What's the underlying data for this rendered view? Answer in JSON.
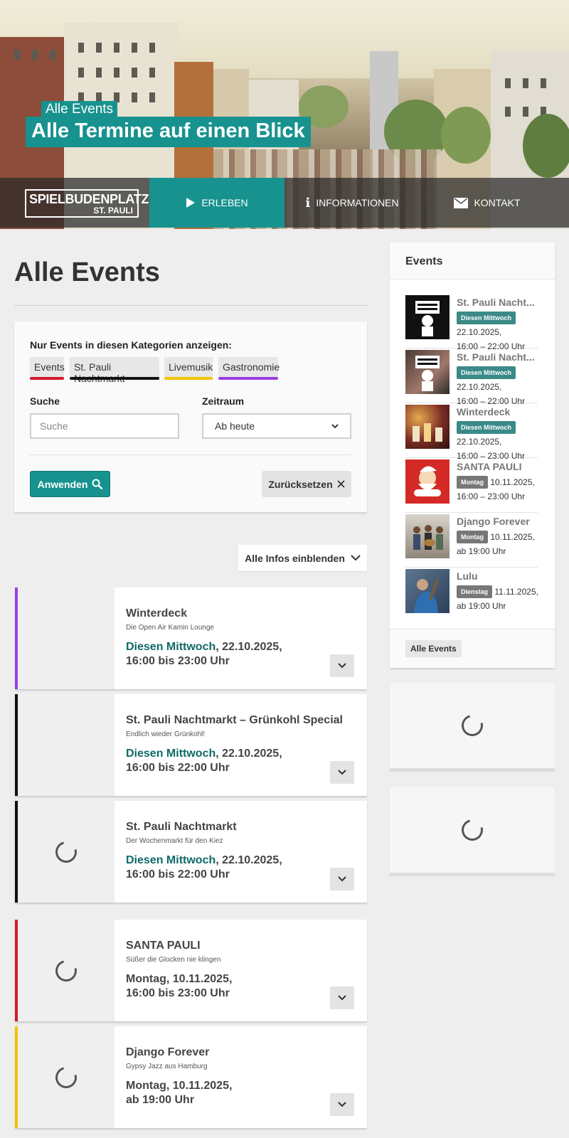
{
  "hero": {
    "subtitle": "Alle Events",
    "title": "Alle Termine auf einen Blick"
  },
  "logo": {
    "line1": "SPIELBUDENPLATZ",
    "line2": "ST. PAULI"
  },
  "nav": [
    {
      "label": "ERLEBEN",
      "icon": "play-icon",
      "active": true
    },
    {
      "label": "INFORMATIONEN",
      "icon": "info-icon",
      "active": false
    },
    {
      "label": "KONTAKT",
      "icon": "envelope-icon",
      "active": false
    }
  ],
  "main": {
    "title": "Alle Events",
    "filter": {
      "category_label": "Nur Events in diesen Kategorien anzeigen:",
      "categories": [
        {
          "label": "Events",
          "color": "#d31a2a"
        },
        {
          "label": "St. Pauli Nachtmarkt",
          "color": "#111111"
        },
        {
          "label": "Livemusik",
          "color": "#f3c400"
        },
        {
          "label": "Gastronomie",
          "color": "#9b3fe0"
        }
      ],
      "search_label": "Suche",
      "search_placeholder": "Suche",
      "period_label": "Zeitraum",
      "period_value": "Ab heute",
      "apply_label": "Anwenden",
      "reset_label": "Zurücksetzen"
    },
    "toggle_label": "Alle Infos einblenden",
    "events": [
      {
        "title": "Winterdeck",
        "subtitle": "Die Open Air Kamin Lounge",
        "day": "Diesen Mittwoch",
        "date": ", 22.10.2025,",
        "time": "16:00 bis 23:00 Uhr",
        "color": "#9b3fe0"
      },
      {
        "title": "St. Pauli Nachtmarkt – Grünkohl Special",
        "subtitle": "Endlich wieder Grünkohl!",
        "day": "Diesen Mittwoch",
        "date": ", 22.10.2025,",
        "time": "16:00 bis 22:00 Uhr",
        "color": "#111111"
      },
      {
        "title": "St. Pauli Nachtmarkt",
        "subtitle": "Der Wochenmarkt für den Kiez",
        "day": "Diesen Mittwoch",
        "date": ", 22.10.2025,",
        "time": "16:00 bis 22:00 Uhr",
        "color": "#111111"
      },
      {
        "title": "SANTA PAULI",
        "subtitle": "Süßer die Glocken nie klingen",
        "day": "",
        "date": "Montag, 10.11.2025,",
        "time": "16:00 bis 23:00 Uhr",
        "color": "#d31a2a"
      },
      {
        "title": "Django Forever",
        "subtitle": "Gypsy Jazz aus Hamburg",
        "day": "",
        "date": "Montag, 10.11.2025,",
        "time": "ab 19:00 Uhr",
        "color": "#f3c400"
      }
    ]
  },
  "sidebar": {
    "title": "Events",
    "items": [
      {
        "name": "St. Pauli Nacht...",
        "badge": "Diesen Mittwoch",
        "badge_style": "teal",
        "date": "22.10.2025,",
        "time": "16:00 – 22:00 Uhr"
      },
      {
        "name": "St. Pauli Nacht...",
        "badge": "Diesen Mittwoch",
        "badge_style": "teal",
        "date": "22.10.2025,",
        "time": "16:00 – 22:00 Uhr"
      },
      {
        "name": "Winterdeck",
        "badge": "Diesen Mittwoch",
        "badge_style": "teal",
        "date": "22.10.2025,",
        "time": "16:00 – 23:00 Uhr"
      },
      {
        "name": "SANTA PAULI",
        "badge": "Montag",
        "badge_style": "grey",
        "date": "10.11.2025,",
        "time": "16:00 – 23:00 Uhr"
      },
      {
        "name": "Django Forever",
        "badge": "Montag",
        "badge_style": "grey",
        "date": "10.11.2025,",
        "time": "ab 19:00 Uhr"
      },
      {
        "name": "Lulu",
        "badge": "Dienstag",
        "badge_style": "grey",
        "date": "11.11.2025,",
        "time": "ab 19:00 Uhr"
      }
    ],
    "all_label": "Alle Events"
  }
}
